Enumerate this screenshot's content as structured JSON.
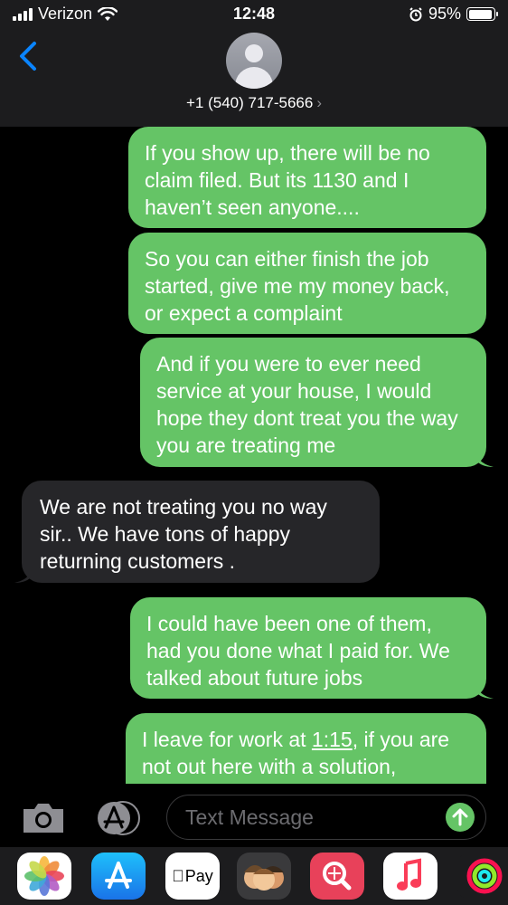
{
  "status_bar": {
    "carrier": "Verizon",
    "time": "12:48",
    "battery_percent": "95%",
    "battery_level": 0.95
  },
  "header": {
    "phone_number": "+1 (540) 717-5666",
    "chevron": "›"
  },
  "messages": [
    {
      "type": "sent",
      "text": "If you show up, there will be no claim filed. But its 1130 and I haven’t seen anyone...."
    },
    {
      "type": "sent",
      "text": "So you can either finish the job started, give me my money back, or expect a complaint"
    },
    {
      "type": "sent",
      "text": "And if you were to ever need service at your house, I would hope they dont treat you the way you are treating me"
    },
    {
      "type": "received",
      "text": "We are not treating you no way sir.. We have tons of happy returning customers ."
    },
    {
      "type": "sent",
      "text": "I could have been one of them, had you done what I paid for. We talked about future jobs"
    },
    {
      "type": "sent",
      "text_before": "I leave for work at ",
      "link": "1:15",
      "text_after": ", if you are not out here with a solution,"
    }
  ],
  "composer": {
    "placeholder": "Text Message"
  },
  "app_drawer": {
    "applepay_label": "Pay",
    "icons": [
      "photos-icon",
      "app-store-icon",
      "apple-pay-icon",
      "memoji-icon",
      "web-search-icon",
      "music-icon",
      "activity-icon"
    ]
  },
  "colors": {
    "sent_bubble": "#65c466",
    "received_bubble": "#262629",
    "accent_blue": "#0a84ff"
  }
}
